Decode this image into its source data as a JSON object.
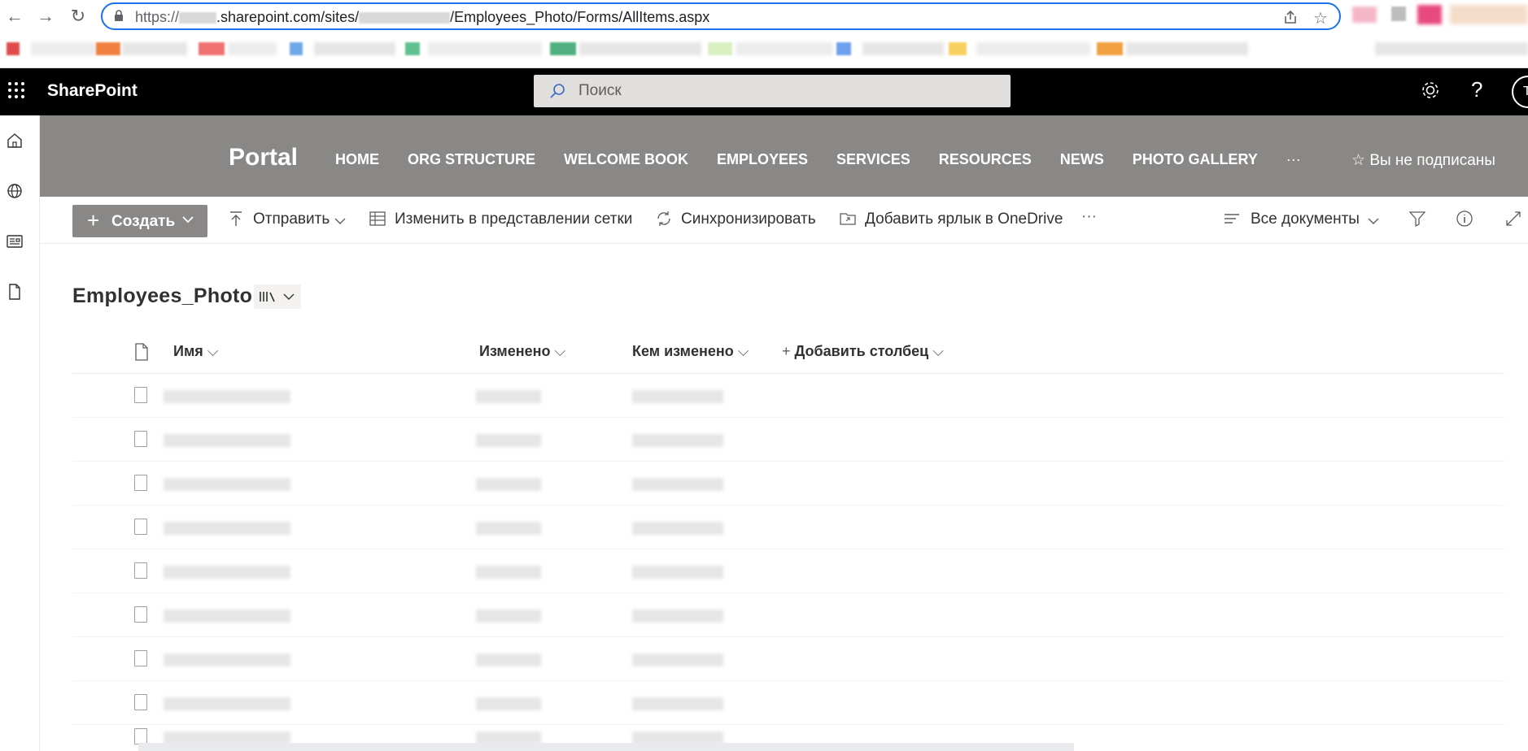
{
  "browser": {
    "url_prefix": "https://",
    "url_mid1": ".sharepoint.com/sites/",
    "url_mid2": "/Employees_Photo/Forms/AllItems.aspx",
    "accent": "#1a73e8"
  },
  "suite": {
    "brand": "SharePoint",
    "search_placeholder": "Поиск",
    "help": "?",
    "avatar_initial": "T"
  },
  "site": {
    "title": "Portal",
    "nav": [
      "HOME",
      "ORG STRUCTURE",
      "WELCOME BOOK",
      "EMPLOYEES",
      "SERVICES",
      "RESOURCES",
      "NEWS",
      "PHOTO GALLERY",
      "···"
    ],
    "follow": "Вы не подписаны",
    "header_color": "#8a8886"
  },
  "commands": {
    "new": "Создать",
    "send": "Отправить",
    "grid_edit": "Изменить в представлении сетки",
    "sync": "Синхронизировать",
    "shortcut": "Добавить ярлык в OneDrive",
    "more": "···",
    "view": "Все документы"
  },
  "library": {
    "title": "Employees_Photo",
    "columns": {
      "name": "Имя",
      "modified": "Изменено",
      "modified_by": "Кем изменено",
      "add_column": "Добавить столбец"
    }
  }
}
